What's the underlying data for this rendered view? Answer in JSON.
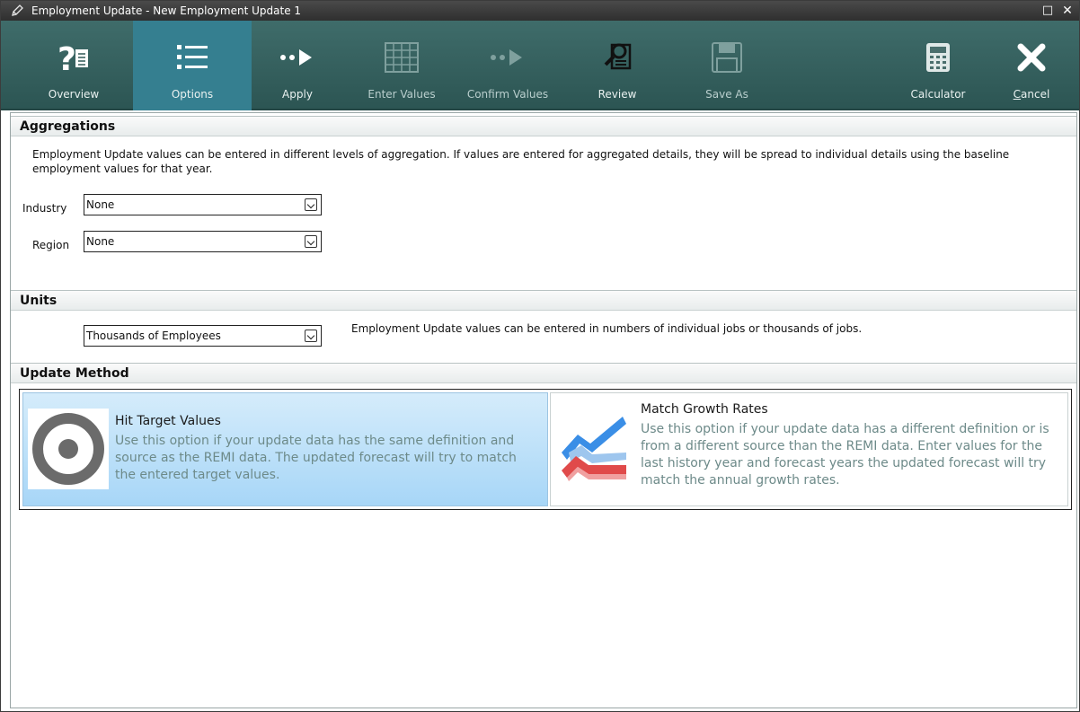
{
  "window": {
    "title": "Employment Update - New Employment Update 1",
    "maximize_glyph": "□",
    "close_glyph": "✕"
  },
  "toolbar": {
    "buttons": [
      {
        "label": "Overview",
        "icon": "overview-icon",
        "state": "enabled"
      },
      {
        "label": "Options",
        "icon": "options-list-icon",
        "state": "active"
      },
      {
        "label": "Apply",
        "icon": "apply-arrow-icon",
        "state": "enabled"
      },
      {
        "label": "Enter Values",
        "icon": "grid-icon",
        "state": "disabled"
      },
      {
        "label": "Confirm Values",
        "icon": "confirm-arrow-icon",
        "state": "disabled"
      },
      {
        "label": "Review",
        "icon": "review-magnifier-icon",
        "state": "enabled"
      },
      {
        "label": "Save As",
        "icon": "save-icon",
        "state": "disabled"
      },
      {
        "label": "Calculator",
        "icon": "calculator-icon",
        "state": "enabled"
      },
      {
        "label": "Cancel",
        "icon": "cancel-x-icon",
        "state": "enabled"
      }
    ]
  },
  "aggregations": {
    "header": "Aggregations",
    "description": "Employment Update values can be entered in different levels of aggregation. If values are entered for aggregated details, they will be spread to individual details using the baseline employment values for that year.",
    "industry_label": "Industry",
    "industry_value": "None",
    "region_label": "Region",
    "region_value": "None"
  },
  "units": {
    "header": "Units",
    "value": "Thousands of Employees",
    "description": "Employment Update values can be entered in numbers of individual jobs or thousands of jobs."
  },
  "update_method": {
    "header": "Update Method",
    "options": [
      {
        "title": "Hit Target Values",
        "description": "Use this option if your update data has the same definition and source as the REMI data. The updated forecast will try to match the entered target values.",
        "selected": true
      },
      {
        "title": "Match Growth Rates",
        "description": "Use this option if your update data has a different definition or is from a different source than the REMI data. Enter values for the last history year and forecast years the updated forecast will try match the annual growth rates.",
        "selected": false
      }
    ]
  },
  "colors": {
    "toolbar_bg": "#356260",
    "toolbar_active": "#357f90",
    "selected_card": "#a7d6f7",
    "blue_line": "#3a8ee6",
    "red_line": "#e04a4a"
  }
}
